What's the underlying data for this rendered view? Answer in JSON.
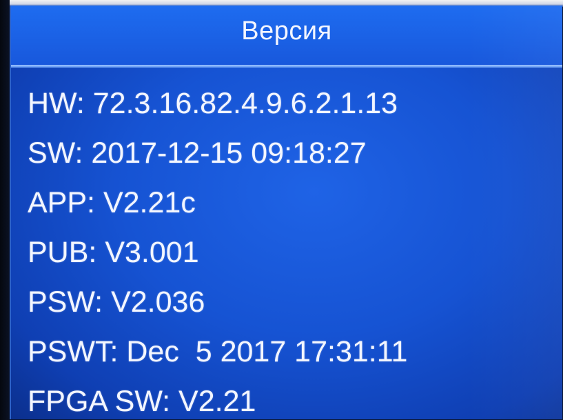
{
  "screen": {
    "title": "Версия",
    "entries": [
      {
        "key": "HW:",
        "value": "72.3.16.82.4.9.6.2.1.13"
      },
      {
        "key": "SW:",
        "value": "2017-12-15 09:18:27"
      },
      {
        "key": "APP:",
        "value": "V2.21c"
      },
      {
        "key": "PUB:",
        "value": "V3.001"
      },
      {
        "key": "PSW:",
        "value": "V2.036"
      },
      {
        "key": "PSWT:",
        "value": "Dec  5 2017 17:31:11"
      },
      {
        "key": "FPGA SW:",
        "value": "V2.21"
      }
    ]
  },
  "colors": {
    "screen_background": "#1653d3",
    "header_background": "#1e6cf0",
    "divider": "#9cc3ff",
    "text": "#f3f6ff"
  }
}
